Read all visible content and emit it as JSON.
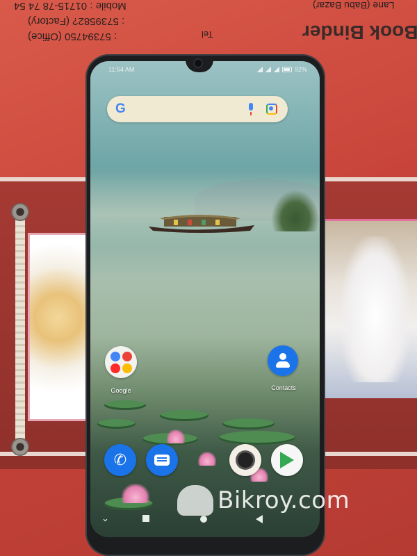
{
  "background_print": {
    "line1": "Mobile : 01715-78 74 54",
    "line2": ": 5739582? (Factory)",
    "line3": ": 57394750 (Office)",
    "line4": "Tel",
    "brand": "Book Binder",
    "address": "Lane (Babu Bazar)"
  },
  "status_bar": {
    "time": "11:54 AM",
    "battery": "92%"
  },
  "home": {
    "folder_label": "Google",
    "contacts_label": "Contacts"
  },
  "icons": {
    "google": "google-g-icon",
    "mic": "microphone-icon",
    "lens": "google-lens-icon",
    "phone": "phone-icon",
    "messages": "messages-icon",
    "camera": "camera-icon",
    "play": "play-store-icon",
    "contacts": "contacts-icon"
  },
  "watermark": {
    "text": "Bikroy.com"
  },
  "colors": {
    "search_bar": "#f1ead2",
    "accent_blue": "#1a73e8",
    "binder_red": "#c7443a"
  }
}
